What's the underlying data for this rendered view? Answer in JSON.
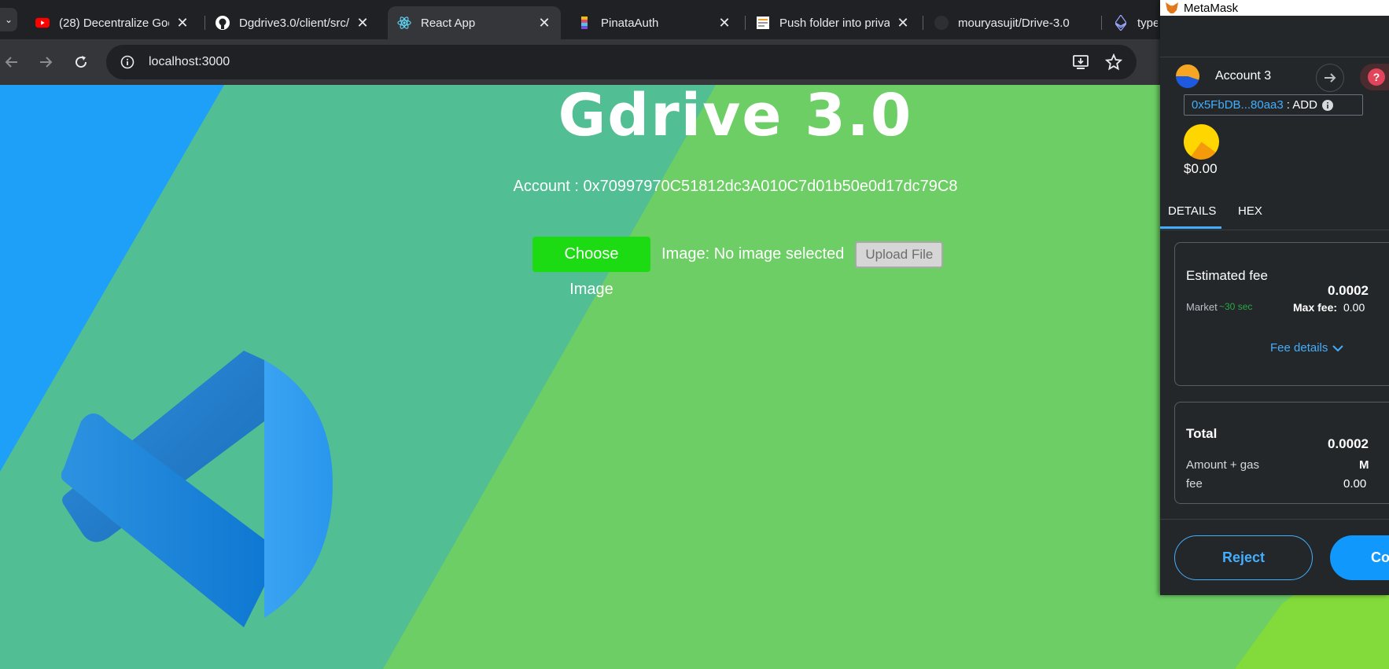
{
  "browser": {
    "tabs": [
      {
        "title": "(28) Decentralize Goo",
        "icon": "youtube-icon",
        "active": false
      },
      {
        "title": "Dgdrive3.0/client/src/",
        "icon": "github-icon",
        "active": false
      },
      {
        "title": "React App",
        "icon": "react-icon",
        "active": true
      },
      {
        "title": "PinataAuth",
        "icon": "pinata-icon",
        "active": false
      },
      {
        "title": "Push folder into priva",
        "icon": "page-icon",
        "active": false
      },
      {
        "title": "mouryasujit/Drive-3.0",
        "icon": "github-icon",
        "active": false
      },
      {
        "title": "type",
        "icon": "ethereum-icon",
        "active": false
      }
    ],
    "url": "localhost:3000"
  },
  "app": {
    "title": "Gdrive 3.0",
    "account_line": "Account : 0x70997970C51812dc3A010C7d01b50e0d17dc79C8",
    "choose_button": "Choose Image",
    "image_label": "Image: No image selected",
    "upload_button": "Upload File"
  },
  "metamask": {
    "window_title": "MetaMask",
    "account_name": "Account 3",
    "address_short": "0x5FbDB...80aa3",
    "address_suffix": ": ADD",
    "balance": "$0.00",
    "tabs": [
      "DETAILS",
      "HEX"
    ],
    "fee": {
      "label": "Estimated fee",
      "value": "0.0002",
      "market": "Market",
      "time": "~30 sec",
      "max_fee_label": "Max fee:",
      "max_fee_value": "0.00",
      "details_link": "Fee details"
    },
    "total": {
      "label": "Total",
      "value": "0.0002",
      "amount_gas": "Amount + gas",
      "amount_gas_value": "M",
      "fee": "fee",
      "fee_value": "0.00"
    },
    "reject_button": "Reject",
    "confirm_button": "Co"
  },
  "colors": {
    "accent_blue": "#43aefc",
    "choose_green": "#1ddb12",
    "page_green": "#6cce64",
    "page_teal": "#52be94",
    "page_blue": "#1ea0f9"
  }
}
